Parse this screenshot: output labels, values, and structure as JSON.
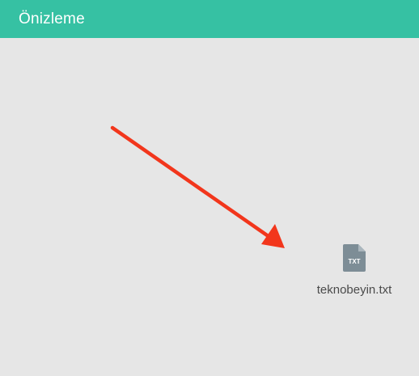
{
  "header": {
    "title": "Önizleme",
    "bg_color": "#36c1a3"
  },
  "preview": {
    "bg_color": "#e6e6e6",
    "annotation_color": "#f2361c",
    "file": {
      "icon": "txt-file-icon",
      "icon_label": "TXT",
      "name": "teknobeyin.txt"
    }
  }
}
